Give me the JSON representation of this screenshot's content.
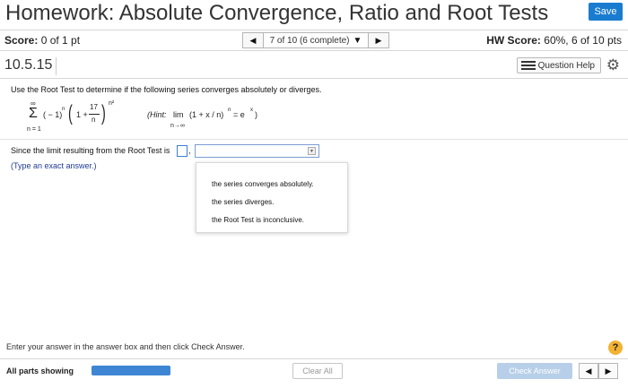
{
  "header": {
    "title": "Homework: Absolute Convergence, Ratio and Root Tests",
    "save_label": "Save"
  },
  "score_bar": {
    "score_label": "Score:",
    "score_value": "0 of 1 pt",
    "question_select": "7 of 10 (6 complete)",
    "hw_score_label": "HW Score:",
    "hw_score_value": "60%, 6 of 10 pts",
    "prev_icon": "triangle-left-icon",
    "next_icon": "triangle-right-icon"
  },
  "question": {
    "number": "10.5.15",
    "help_label": "Question Help"
  },
  "problem": {
    "instruction": "Use the Root Test to determine if the following series converges absolutely or diverges.",
    "sum_top": "∞",
    "sum_symbol": "Σ",
    "sum_bottom": "n = 1",
    "term_sign": "( − 1)",
    "term_sign_exp": "n",
    "paren_open": "(",
    "one_plus": "1 +",
    "frac_num": "17",
    "frac_den": "n",
    "paren_close": ")",
    "outer_exp": "n²",
    "hint_label": "(Hint:",
    "hint_lim": "lim",
    "hint_lim_sub": "n→∞",
    "hint_expr": "(1 + x / n)",
    "hint_expr_exp": "n",
    "hint_eq": "= e",
    "hint_eq_exp": "x",
    "hint_close": ")"
  },
  "answer": {
    "since_text": "Since the limit resulting from the Root Test is",
    "comma": ",",
    "type_hint": "(Type an exact answer.)",
    "options": [
      "the series converges absolutely.",
      "the series diverges.",
      "the Root Test is inconclusive."
    ]
  },
  "footer": {
    "message": "Enter your answer in the answer box and then click Check Answer.",
    "help_symbol": "?",
    "all_parts": "All parts showing",
    "clear_label": "Clear All",
    "check_label": "Check Answer"
  },
  "colors": {
    "accent": "#1a7cd0",
    "progress": "#3e86d4",
    "check_disabled": "#b7cfe8",
    "help_yellow": "#f2b233"
  }
}
